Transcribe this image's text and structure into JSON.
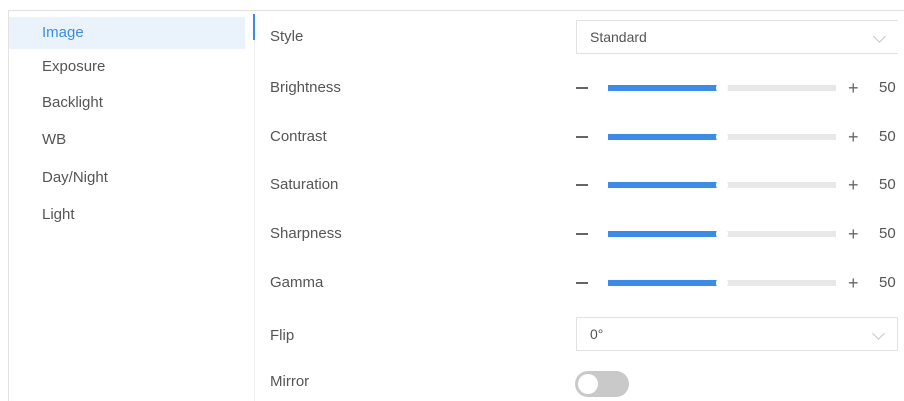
{
  "sidebar": {
    "items": [
      {
        "label": "Image",
        "active": true
      },
      {
        "label": "Exposure",
        "active": false
      },
      {
        "label": "Backlight",
        "active": false
      },
      {
        "label": "WB",
        "active": false
      },
      {
        "label": "Day/Night",
        "active": false
      },
      {
        "label": "Light",
        "active": false
      }
    ]
  },
  "settings": {
    "style": {
      "label": "Style",
      "value": "Standard"
    },
    "sliders": [
      {
        "label": "Brightness",
        "value": 50,
        "min": 0,
        "max": 100,
        "minus": "−",
        "plus": "+"
      },
      {
        "label": "Contrast",
        "value": 50,
        "min": 0,
        "max": 100,
        "minus": "−",
        "plus": "+"
      },
      {
        "label": "Saturation",
        "value": 50,
        "min": 0,
        "max": 100,
        "minus": "−",
        "plus": "+"
      },
      {
        "label": "Sharpness",
        "value": 50,
        "min": 0,
        "max": 100,
        "minus": "−",
        "plus": "+"
      },
      {
        "label": "Gamma",
        "value": 50,
        "min": 0,
        "max": 100,
        "minus": "−",
        "plus": "+"
      }
    ],
    "flip": {
      "label": "Flip",
      "value": "0°"
    },
    "mirror": {
      "label": "Mirror",
      "enabled": false
    }
  },
  "colors": {
    "accent": "#3c8ce7",
    "track": "#e8e8e8",
    "toggle_off": "#c9c9c9"
  }
}
